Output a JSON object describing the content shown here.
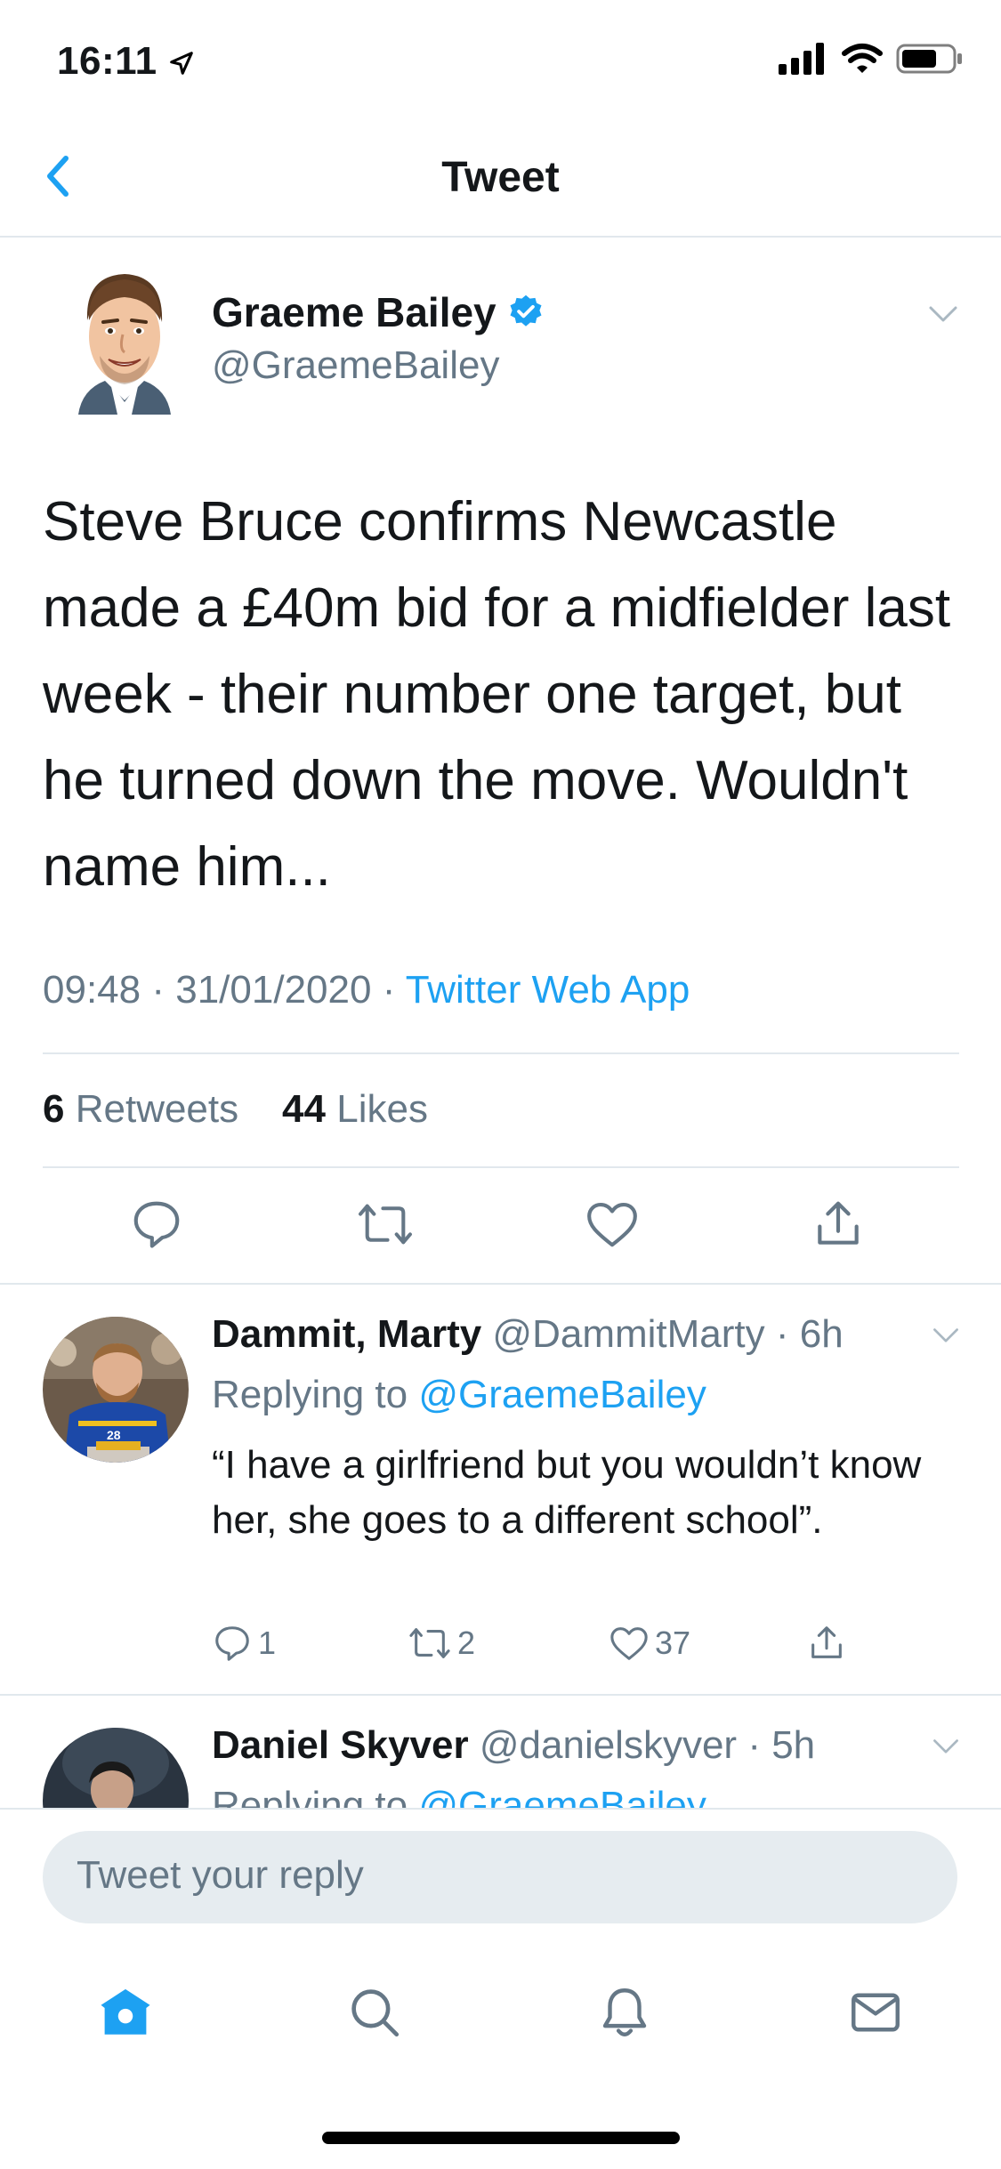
{
  "status_bar": {
    "time": "16:11"
  },
  "nav": {
    "title": "Tweet"
  },
  "tweet": {
    "name": "Graeme Bailey",
    "handle": "@GraemeBailey",
    "text": "Steve Bruce confirms Newcastle made a £40m bid for a midfielder last week - their number one target, but he turned down the move. Wouldn't name him...",
    "time": "09:48",
    "date": "31/01/2020",
    "sep": "·",
    "source": "Twitter Web App",
    "retweets_count": "6",
    "retweets_label": "Retweets",
    "likes_count": "44",
    "likes_label": "Likes"
  },
  "replies": [
    {
      "name": "Dammit, Marty",
      "handle": "@DammitMarty",
      "age": "· 6h",
      "replying_label": "Replying to",
      "replying_to": "@GraemeBailey",
      "text": "“I have a girlfriend but you wouldn’t know her, she goes to a different school”.",
      "reply_count": "1",
      "retweet_count": "2",
      "like_count": "37"
    },
    {
      "name": "Daniel Skyver",
      "handle": "@danielskyver",
      "age": "· 5h",
      "replying_label": "Replying to",
      "replying_to": "@GraemeBailey"
    }
  ],
  "composer": {
    "placeholder": "Tweet your reply"
  },
  "colors": {
    "accent": "#1da1f2",
    "secondary": "#657786",
    "divider": "#e1e8ed"
  },
  "icons": [
    "back-chevron-icon",
    "verified-badge-icon",
    "chevron-down-icon",
    "reply-icon",
    "retweet-icon",
    "like-icon",
    "share-icon",
    "home-icon",
    "search-icon",
    "notifications-icon",
    "messages-icon"
  ]
}
